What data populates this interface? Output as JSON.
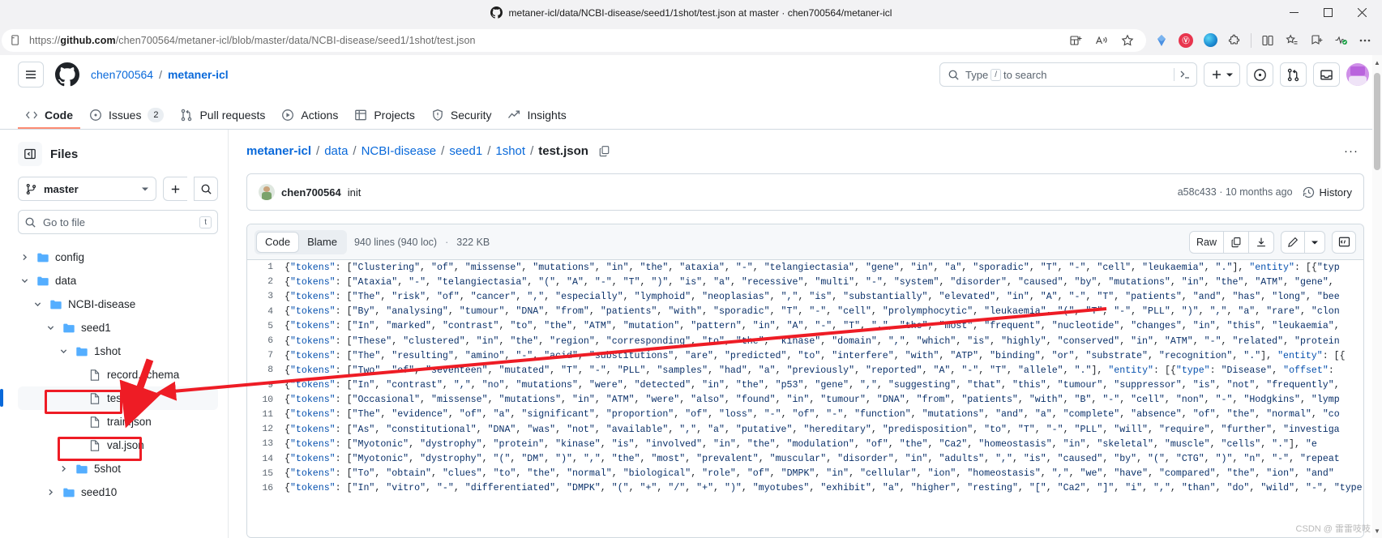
{
  "browser": {
    "tab_title": "metaner-icl/data/NCBI-disease/seed1/1shot/test.json at master · chen700564/metaner-icl",
    "url_prefix": "https://",
    "url_domain": "github.com",
    "url_path": "/chen700564/metaner-icl/blob/master/data/NCBI-disease/seed1/1shot/test.json",
    "window_buttons": [
      "minimize",
      "maximize",
      "close"
    ],
    "toolbar_icons": [
      "split-screen-icon",
      "read-aloud-icon",
      "favorite-star-icon",
      "copilot-icon",
      "extension-red-icon",
      "edge-icon",
      "puzzle-extensions-icon",
      "browser-essentials-icon",
      "collections-icon",
      "add-to-favorites-icon",
      "performance-icon",
      "settings-more-icon"
    ]
  },
  "gh_header": {
    "hamburger": "menu-icon",
    "logo": "github-logo",
    "owner": "chen700564",
    "separator": "/",
    "repo": "metaner-icl",
    "search_placeholder": "Type",
    "search_key": "/",
    "search_suffix": "to search",
    "command_palette": "command-palette-icon",
    "plus_label": "+",
    "icons": [
      "issue-opened-icon",
      "pull-request-icon",
      "inbox-icon"
    ],
    "avatar": "user-avatar"
  },
  "nav": {
    "items": [
      {
        "label": "Code",
        "icon": "code-icon",
        "active": true,
        "count": null
      },
      {
        "label": "Issues",
        "icon": "issue-opened-icon",
        "active": false,
        "count": "2"
      },
      {
        "label": "Pull requests",
        "icon": "pull-request-icon",
        "active": false,
        "count": null
      },
      {
        "label": "Actions",
        "icon": "play-icon",
        "active": false,
        "count": null
      },
      {
        "label": "Projects",
        "icon": "table-icon",
        "active": false,
        "count": null
      },
      {
        "label": "Security",
        "icon": "shield-icon",
        "active": false,
        "count": null
      },
      {
        "label": "Insights",
        "icon": "graph-icon",
        "active": false,
        "count": null
      }
    ]
  },
  "sidebar": {
    "title": "Files",
    "toggle_icon": "sidebar-collapse-icon",
    "branch": "master",
    "branch_icon": "git-branch-icon",
    "add_icon": "plus-icon",
    "search_icon": "search-icon",
    "gotofile_placeholder": "Go to file",
    "gotofile_key": "t",
    "tree": [
      {
        "label": "config",
        "type": "folder",
        "depth": 0,
        "state": "collapsed",
        "selected": false,
        "highlight": false
      },
      {
        "label": "data",
        "type": "folder",
        "depth": 0,
        "state": "expanded",
        "selected": false,
        "highlight": false
      },
      {
        "label": "NCBI-disease",
        "type": "folder",
        "depth": 1,
        "state": "expanded",
        "selected": false,
        "highlight": false
      },
      {
        "label": "seed1",
        "type": "folder",
        "depth": 2,
        "state": "expanded",
        "selected": false,
        "highlight": false
      },
      {
        "label": "1shot",
        "type": "folder",
        "depth": 3,
        "state": "expanded",
        "selected": false,
        "highlight": true
      },
      {
        "label": "record.schema",
        "type": "file",
        "depth": 4,
        "state": "none",
        "selected": false,
        "highlight": false
      },
      {
        "label": "test.json",
        "type": "file",
        "depth": 4,
        "state": "none",
        "selected": true,
        "highlight": true
      },
      {
        "label": "train.json",
        "type": "file",
        "depth": 4,
        "state": "none",
        "selected": false,
        "highlight": false
      },
      {
        "label": "val.json",
        "type": "file",
        "depth": 4,
        "state": "none",
        "selected": false,
        "highlight": false
      },
      {
        "label": "5shot",
        "type": "folder",
        "depth": 3,
        "state": "collapsed",
        "selected": false,
        "highlight": false
      },
      {
        "label": "seed10",
        "type": "folder",
        "depth": 2,
        "state": "collapsed",
        "selected": false,
        "highlight": false
      }
    ]
  },
  "breadcrumb": {
    "parts": [
      "metaner-icl",
      "data",
      "NCBI-disease",
      "seed1",
      "1shot"
    ],
    "current": "test.json",
    "copy_icon": "copy-path-icon",
    "more_icon": "kebab-menu-icon"
  },
  "commit": {
    "author": "chen700564",
    "message": "init",
    "sha": "a58c433",
    "relative_time": "10 months ago",
    "separator": "·",
    "history_label": "History",
    "history_icon": "history-icon"
  },
  "code_toolbar": {
    "tabs": [
      {
        "label": "Code",
        "active": true
      },
      {
        "label": "Blame",
        "active": false
      }
    ],
    "lines": "940 lines (940 loc)",
    "dot": "·",
    "size": "322 KB",
    "raw_label": "Raw",
    "copy_icon": "copy-icon",
    "download_icon": "download-icon",
    "edit_icon": "pencil-icon",
    "caret_icon": "chevron-down-icon",
    "symbols_icon": "code-symbols-icon"
  },
  "code": {
    "lines": [
      {
        "n": "1",
        "text": "{\"tokens\": [\"Clustering\", \"of\", \"missense\", \"mutations\", \"in\", \"the\", \"ataxia\", \"-\", \"telangiectasia\", \"gene\", \"in\", \"a\", \"sporadic\", \"T\", \"-\", \"cell\", \"leukaemia\", \".\"], \"entity\": [{\"typ"
      },
      {
        "n": "2",
        "text": "{\"tokens\": [\"Ataxia\", \"-\", \"telangiectasia\", \"(\", \"A\", \"-\", \"T\", \")\", \"is\", \"a\", \"recessive\", \"multi\", \"-\", \"system\", \"disorder\", \"caused\", \"by\", \"mutations\", \"in\", \"the\", \"ATM\", \"gene\","
      },
      {
        "n": "3",
        "text": "{\"tokens\": [\"The\", \"risk\", \"of\", \"cancer\", \",\", \"especially\", \"lymphoid\", \"neoplasias\", \",\", \"is\", \"substantially\", \"elevated\", \"in\", \"A\", \"-\", \"T\", \"patients\", \"and\", \"has\", \"long\", \"bee"
      },
      {
        "n": "4",
        "text": "{\"tokens\": [\"By\", \"analysing\", \"tumour\", \"DNA\", \"from\", \"patients\", \"with\", \"sporadic\", \"T\", \"-\", \"cell\", \"prolymphocytic\", \"leukaemia\", \"(\", \"T\", \"-\", \"PLL\", \")\", \",\", \"a\", \"rare\", \"clon"
      },
      {
        "n": "5",
        "text": "{\"tokens\": [\"In\", \"marked\", \"contrast\", \"to\", \"the\", \"ATM\", \"mutation\", \"pattern\", \"in\", \"A\", \"-\", \"T\", \",\", \"the\", \"most\", \"frequent\", \"nucleotide\", \"changes\", \"in\", \"this\", \"leukaemia\","
      },
      {
        "n": "6",
        "text": "{\"tokens\": [\"These\", \"clustered\", \"in\", \"the\", \"region\", \"corresponding\", \"to\", \"the\", \"kinase\", \"domain\", \",\", \"which\", \"is\", \"highly\", \"conserved\", \"in\", \"ATM\", \"-\", \"related\", \"protein"
      },
      {
        "n": "7",
        "text": "{\"tokens\": [\"The\", \"resulting\", \"amino\", \"-\", \"acid\", \"substitutions\", \"are\", \"predicted\", \"to\", \"interfere\", \"with\", \"ATP\", \"binding\", \"or\", \"substrate\", \"recognition\", \".\"], \"entity\": [{"
      },
      {
        "n": "8",
        "text": "{\"tokens\": [\"Two\", \"of\", \"seventeen\", \"mutated\", \"T\", \"-\", \"PLL\", \"samples\", \"had\", \"a\", \"previously\", \"reported\", \"A\", \"-\", \"T\", \"allele\", \".\"], \"entity\": [{\"type\": \"Disease\", \"offset\":"
      },
      {
        "n": "9",
        "text": "{\"tokens\": [\"In\", \"contrast\", \",\", \"no\", \"mutations\", \"were\", \"detected\", \"in\", \"the\", \"p53\", \"gene\", \",\", \"suggesting\", \"that\", \"this\", \"tumour\", \"suppressor\", \"is\", \"not\", \"frequently\","
      },
      {
        "n": "10",
        "text": "{\"tokens\": [\"Occasional\", \"missense\", \"mutations\", \"in\", \"ATM\", \"were\", \"also\", \"found\", \"in\", \"tumour\", \"DNA\", \"from\", \"patients\", \"with\", \"B\", \"-\", \"cell\", \"non\", \"-\", \"Hodgkins\", \"lymp"
      },
      {
        "n": "11",
        "text": "{\"tokens\": [\"The\", \"evidence\", \"of\", \"a\", \"significant\", \"proportion\", \"of\", \"loss\", \"-\", \"of\", \"-\", \"function\", \"mutations\", \"and\", \"a\", \"complete\", \"absence\", \"of\", \"the\", \"normal\", \"co"
      },
      {
        "n": "12",
        "text": "{\"tokens\": [\"As\", \"constitutional\", \"DNA\", \"was\", \"not\", \"available\", \",\", \"a\", \"putative\", \"hereditary\", \"predisposition\", \"to\", \"T\", \"-\", \"PLL\", \"will\", \"require\", \"further\", \"investiga"
      },
      {
        "n": "13",
        "text": "{\"tokens\": [\"Myotonic\", \"dystrophy\", \"protein\", \"kinase\", \"is\", \"involved\", \"in\", \"the\", \"modulation\", \"of\", \"the\", \"Ca2\", \"homeostasis\", \"in\", \"skeletal\", \"muscle\", \"cells\", \".\"], \"e"
      },
      {
        "n": "14",
        "text": "{\"tokens\": [\"Myotonic\", \"dystrophy\", \"(\", \"DM\", \")\", \",\", \"the\", \"most\", \"prevalent\", \"muscular\", \"disorder\", \"in\", \"adults\", \",\", \"is\", \"caused\", \"by\", \"(\", \"CTG\", \")\", \"n\", \"-\", \"repeat"
      },
      {
        "n": "15",
        "text": "{\"tokens\": [\"To\", \"obtain\", \"clues\", \"to\", \"the\", \"normal\", \"biological\", \"role\", \"of\", \"DMPK\", \"in\", \"cellular\", \"ion\", \"homeostasis\", \",\", \"we\", \"have\", \"compared\", \"the\", \"ion\", \"and\""
      },
      {
        "n": "16",
        "text": "{\"tokens\": [\"In\", \"vitro\", \"-\", \"differentiated\", \"DMPK\", \"(\", \"+\", \"/\", \"+\", \")\", \"myotubes\", \"exhibit\", \"a\", \"higher\", \"resting\", \"[\", \"Ca2\", \"]\", \"i\", \",\", \"than\", \"do\", \"wild\", \"-\", \"type\""
      }
    ]
  },
  "annotations": {
    "arrow_color": "#ee1c25",
    "highlight_boxes": [
      "1shot-folder",
      "test-json-file"
    ],
    "arrow_description": "red-arrow-pointing-from-test-json-to-code-lines"
  },
  "watermark": "CSDN @ 雷雷吱吱"
}
